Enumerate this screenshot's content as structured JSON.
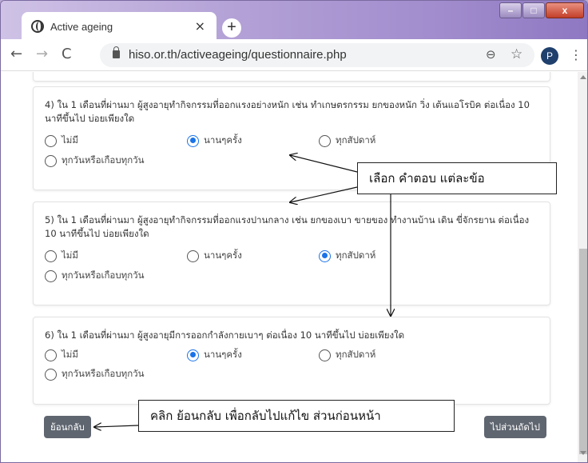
{
  "browser": {
    "tab_title": "Active ageing",
    "tab_close": "×",
    "new_tab": "+",
    "url": "hiso.or.th/activeageing/questionnaire.php",
    "profile_initial": "P",
    "window_controls": {
      "minimize": "–",
      "maximize": "□",
      "close": "x"
    },
    "icons": {
      "back": "←",
      "forward": "→",
      "reload": "C",
      "zoom": "⊖",
      "star": "☆",
      "menu": "⋮"
    }
  },
  "questions": [
    {
      "text": "4) ใน 1 เดือนที่ผ่านมา ผู้สูงอายุทำกิจกรรมที่ออกแรงอย่างหนัก เช่น ทำเกษตรกรรม ยกของหนัก วิ่ง เต้นแอโรบิค ต่อเนื่อง 10 นาทีขึ้นไป บ่อยเพียงใด",
      "options": [
        "ไม่มี",
        "นานๆครั้ง",
        "ทุกสัปดาห์",
        "ทุกวันหรือเกือบทุกวัน"
      ],
      "selected": 1
    },
    {
      "text": "5) ใน 1 เดือนที่ผ่านมา ผู้สูงอายุทำกิจกรรมที่ออกแรงปานกลาง เช่น ยกของเบา ขายของ ทำงานบ้าน เดิน ขี่จักรยาน ต่อเนื่อง 10 นาทีขึ้นไป บ่อยเพียงใด",
      "options": [
        "ไม่มี",
        "นานๆครั้ง",
        "ทุกสัปดาห์",
        "ทุกวันหรือเกือบทุกวัน"
      ],
      "selected": 2
    },
    {
      "text": "6) ใน 1 เดือนที่ผ่านมา ผู้สูงอายุมีการออกกำลังกายเบาๆ ต่อเนื่อง 10 นาทีขึ้นไป บ่อยเพียงใด",
      "options": [
        "ไม่มี",
        "นานๆครั้ง",
        "ทุกสัปดาห์",
        "ทุกวันหรือเกือบทุกวัน"
      ],
      "selected": 1
    }
  ],
  "buttons": {
    "back": "ย้อนกลับ",
    "next": "ไปส่วนถัดไป"
  },
  "annotations": {
    "choose": "เลือก คำตอบ แต่ละข้อ",
    "back_hint": "คลิก ย้อนกลับ เพื่อกลับไปแก้ไข ส่วนก่อนหน้า"
  },
  "colors": {
    "accent": "#1a73e8",
    "button": "#5f6670"
  }
}
